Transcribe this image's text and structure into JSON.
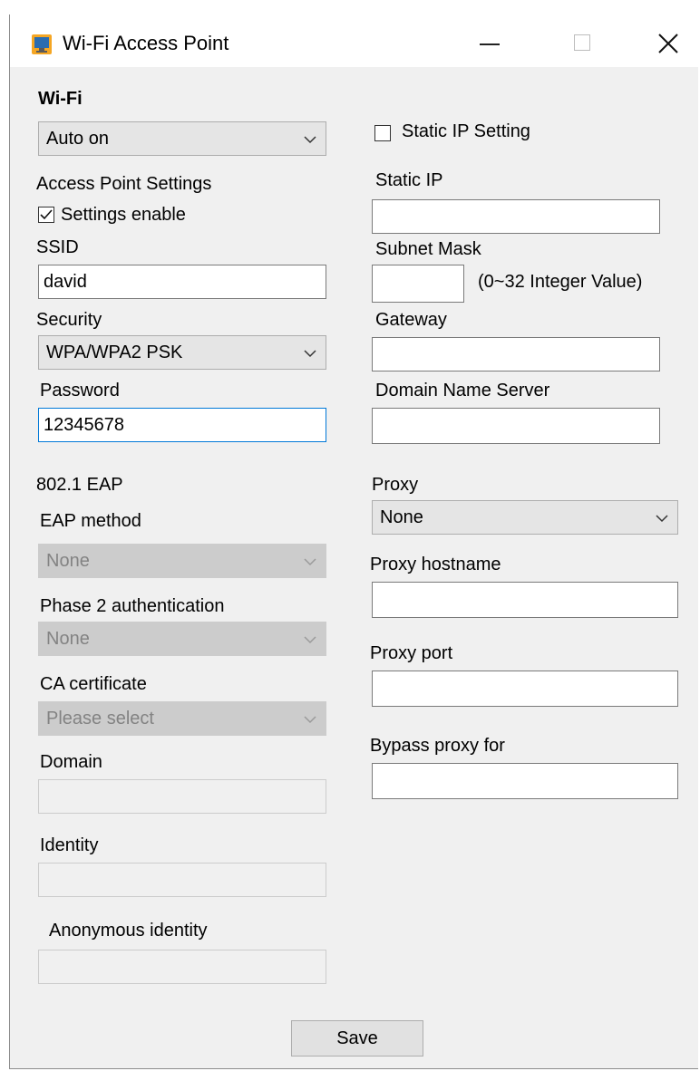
{
  "window": {
    "title": "Wi-Fi Access Point"
  },
  "wifi": {
    "heading": "Wi-Fi",
    "mode_value": "Auto on"
  },
  "ap": {
    "heading": "Access Point Settings",
    "enable_label": "Settings enable",
    "enable_checked": true,
    "ssid_label": "SSID",
    "ssid_value": "david",
    "security_label": "Security",
    "security_value": "WPA/WPA2 PSK",
    "password_label": "Password",
    "password_value": "12345678"
  },
  "eap": {
    "heading": "802.1 EAP",
    "method_label": "EAP method",
    "method_value": "None",
    "phase2_label": "Phase 2 authentication",
    "phase2_value": "None",
    "ca_label": "CA certificate",
    "ca_value": "Please select",
    "domain_label": "Domain",
    "domain_value": "",
    "identity_label": "Identity",
    "identity_value": "",
    "anon_label": "Anonymous identity",
    "anon_value": ""
  },
  "ip": {
    "static_label": "Static IP Setting",
    "static_checked": false,
    "static_ip_label": "Static IP",
    "static_ip_value": "",
    "subnet_label": "Subnet Mask",
    "subnet_value": "",
    "subnet_hint": "(0~32 Integer Value)",
    "gateway_label": "Gateway",
    "gateway_value": "",
    "dns_label": "Domain Name Server",
    "dns_value": ""
  },
  "proxy": {
    "label": "Proxy",
    "value": "None",
    "hostname_label": "Proxy hostname",
    "hostname_value": "",
    "port_label": "Proxy port",
    "port_value": "",
    "bypass_label": "Bypass proxy for",
    "bypass_value": ""
  },
  "actions": {
    "save_label": "Save"
  }
}
